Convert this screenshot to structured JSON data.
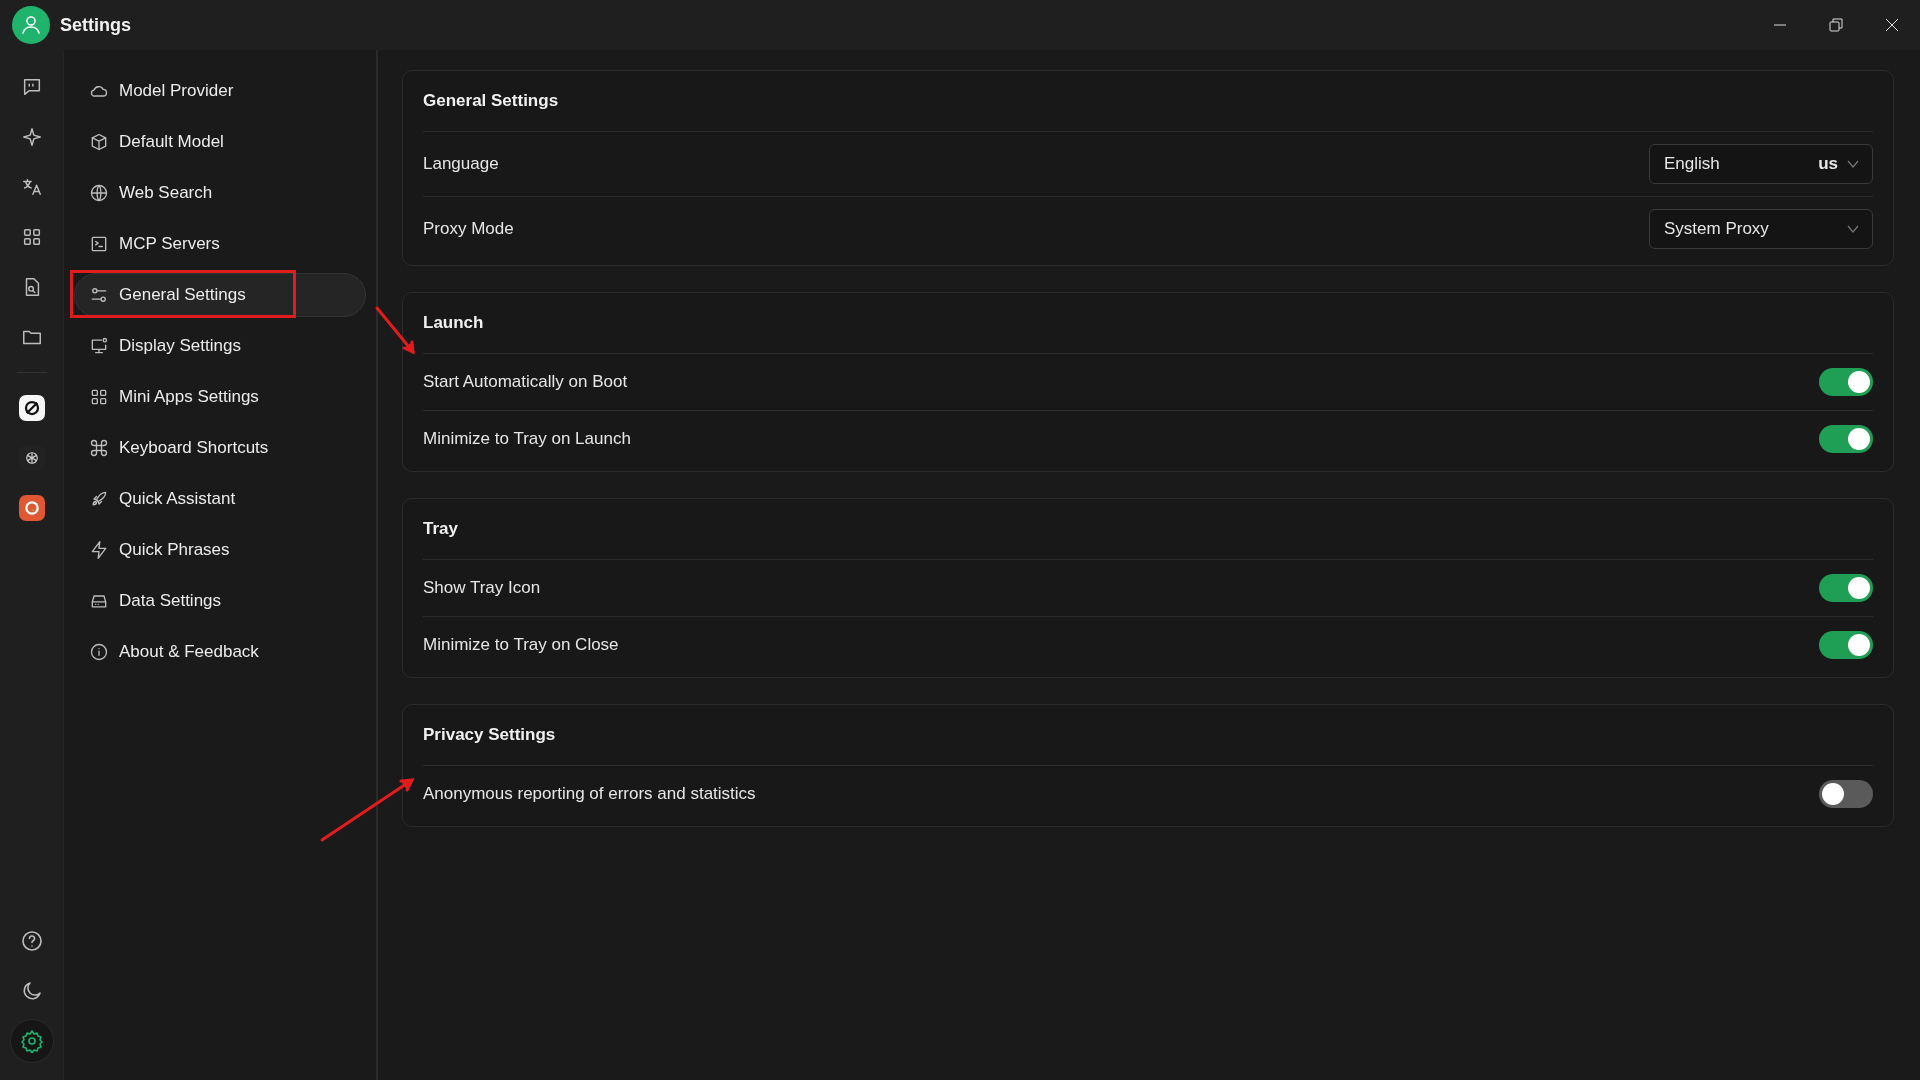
{
  "window": {
    "title": "Settings"
  },
  "rail": {
    "top": [
      {
        "selected": false
      },
      {
        "selected": false
      },
      {
        "selected": false
      },
      {
        "selected": false
      },
      {
        "selected": false
      },
      {
        "selected": false
      }
    ],
    "bottom": [
      {
        "selected": false
      },
      {
        "selected": false
      },
      {
        "selected": true
      }
    ]
  },
  "sidebar": {
    "items": [
      {
        "label": "Model Provider",
        "selected": false,
        "boxed": false
      },
      {
        "label": "Default Model",
        "selected": false,
        "boxed": false
      },
      {
        "label": "Web Search",
        "selected": false,
        "boxed": false
      },
      {
        "label": "MCP Servers",
        "selected": false,
        "boxed": false
      },
      {
        "label": "General Settings",
        "selected": true,
        "boxed": true
      },
      {
        "label": "Display Settings",
        "selected": false,
        "boxed": false
      },
      {
        "label": "Mini Apps Settings",
        "selected": false,
        "boxed": false
      },
      {
        "label": "Keyboard Shortcuts",
        "selected": false,
        "boxed": false
      },
      {
        "label": "Quick Assistant",
        "selected": false,
        "boxed": false
      },
      {
        "label": "Quick Phrases",
        "selected": false,
        "boxed": false
      },
      {
        "label": "Data Settings",
        "selected": false,
        "boxed": false
      },
      {
        "label": "About & Feedback",
        "selected": false,
        "boxed": false
      }
    ]
  },
  "sections": [
    {
      "title": "General Settings",
      "rows": [
        {
          "kind": "select",
          "label": "Language",
          "value": "English",
          "suffix": "us"
        },
        {
          "kind": "select",
          "label": "Proxy Mode",
          "value": "System Proxy"
        }
      ]
    },
    {
      "title": "Launch",
      "rows": [
        {
          "kind": "toggle",
          "label": "Start Automatically on Boot",
          "on": true,
          "arrow": true
        },
        {
          "kind": "toggle",
          "label": "Minimize to Tray on Launch",
          "on": true,
          "arrow": false
        }
      ]
    },
    {
      "title": "Tray",
      "rows": [
        {
          "kind": "toggle",
          "label": "Show Tray Icon",
          "on": true,
          "arrow": false
        },
        {
          "kind": "toggle",
          "label": "Minimize to Tray on Close",
          "on": true,
          "arrow": false
        }
      ]
    },
    {
      "title": "Privacy Settings",
      "rows": [
        {
          "kind": "toggle",
          "label": "Anonymous reporting of errors and statistics",
          "on": false,
          "arrow": true
        }
      ]
    }
  ]
}
